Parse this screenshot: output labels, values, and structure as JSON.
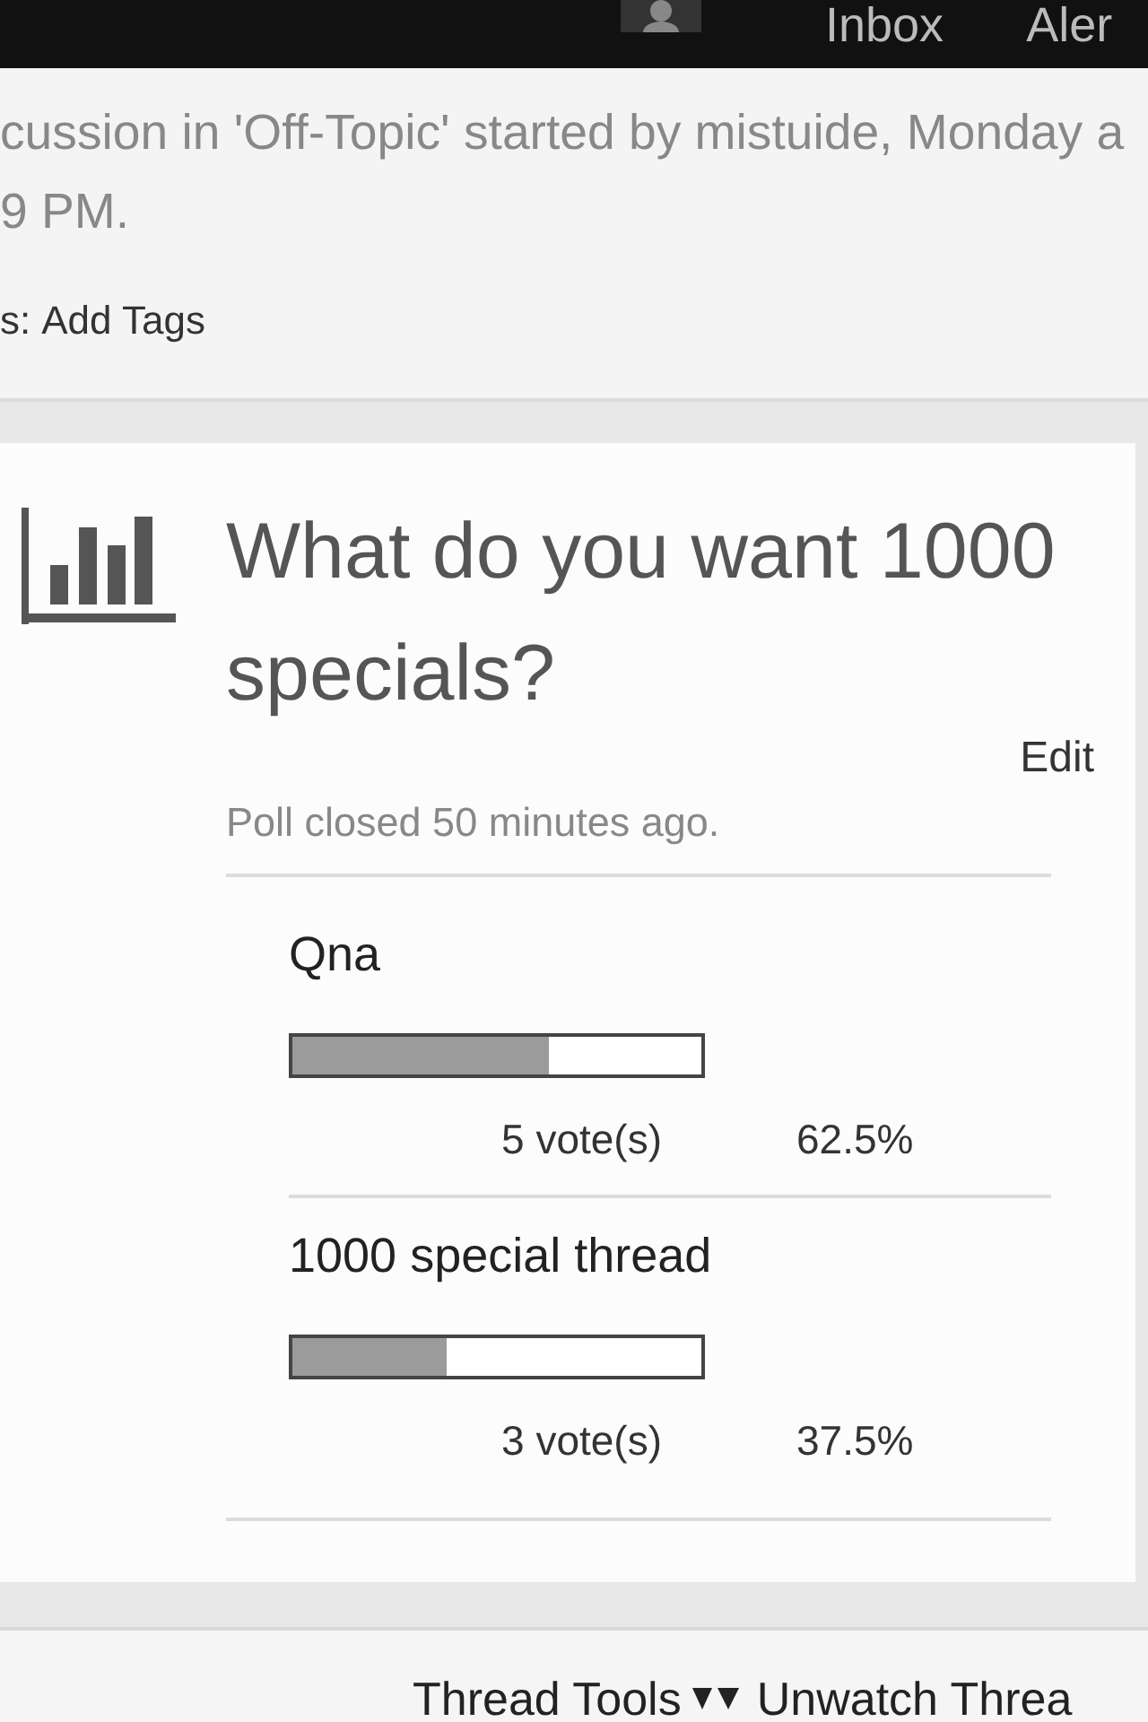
{
  "top_nav": {
    "links": [
      "Inbox",
      "Aler"
    ]
  },
  "thread_meta": {
    "lines": [
      "cussion in 'Off-Topic' started by mistuide, Monday a",
      "9 PM."
    ],
    "tags_label": "s:",
    "tags_link": "Add Tags"
  },
  "poll": {
    "question": "What do you want 1000 specials?",
    "edit": "Edit",
    "status": "Poll closed 50 minutes ago.",
    "options": [
      {
        "label": "Qna",
        "level": 0.625,
        "votes": "5 vote(s)",
        "percent": "62.5%"
      },
      {
        "label": "1000 special thread",
        "level": 0.375,
        "votes": "3 vote(s)",
        "percent": "37.5%"
      }
    ]
  },
  "footer": {
    "links": [
      {
        "kind": "menu",
        "label": "Thread Tools"
      },
      {
        "kind": "link",
        "label": "Unwatch Threa"
      }
    ]
  }
}
